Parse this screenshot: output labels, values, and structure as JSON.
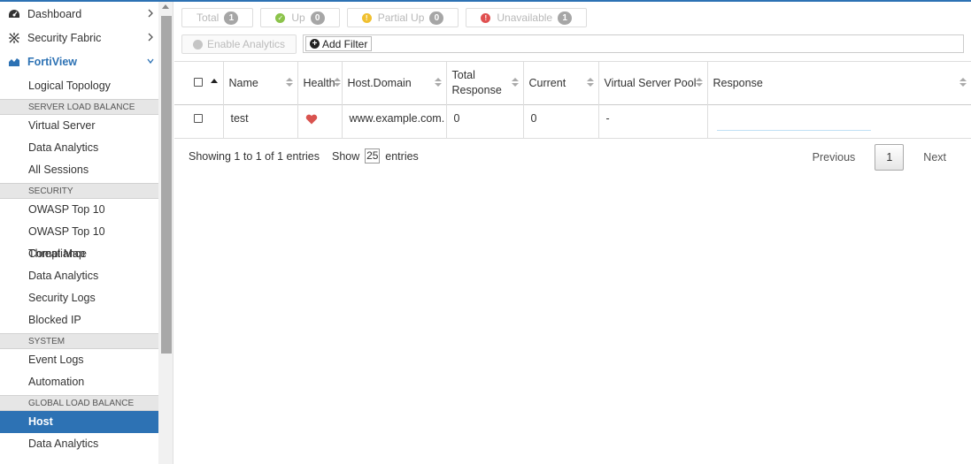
{
  "sidebar": {
    "top_items": [
      {
        "label": "Dashboard",
        "icon": "dashboard-icon"
      },
      {
        "label": "Security Fabric",
        "icon": "security-fabric-icon"
      },
      {
        "label": "FortiView",
        "icon": "fortiview-icon"
      }
    ],
    "logical_topology": "Logical Topology",
    "sections": [
      {
        "title": "SERVER LOAD BALANCE",
        "items": [
          "Virtual Server",
          "Data Analytics",
          "All Sessions"
        ]
      },
      {
        "title": "SECURITY",
        "items": [
          "OWASP Top 10",
          "OWASP Top 10 Compliance",
          "Threat Map",
          "Data Analytics",
          "Security Logs",
          "Blocked IP"
        ]
      },
      {
        "title": "SYSTEM",
        "items": [
          "Event Logs",
          "Automation"
        ]
      },
      {
        "title": "GLOBAL LOAD BALANCE",
        "items": [
          "Host",
          "Data Analytics"
        ]
      }
    ],
    "selected": "Host"
  },
  "status": {
    "total": {
      "label": "Total",
      "count": "1"
    },
    "up": {
      "label": "Up",
      "count": "0",
      "color": "#8bc34a"
    },
    "partial": {
      "label": "Partial Up",
      "count": "0",
      "color": "#f0c030"
    },
    "unavailable": {
      "label": "Unavailable",
      "count": "1",
      "color": "#e05050"
    }
  },
  "toolbar": {
    "enable_analytics": "Enable Analytics",
    "add_filter": "Add Filter"
  },
  "table": {
    "columns": [
      "Name",
      "Health",
      "Host.Domain",
      "Total Response",
      "Current",
      "Virtual Server Pool",
      "Response"
    ],
    "rows": [
      {
        "name": "test",
        "health": "heart-icon",
        "host_domain": "www.example.com.",
        "total_response": "0",
        "current": "0",
        "virtual_server_pool": "-"
      }
    ]
  },
  "footer": {
    "info": "Showing 1 to 1 of 1 entries",
    "show": "Show",
    "page_size": "25",
    "entries": "entries",
    "previous": "Previous",
    "page": "1",
    "next": "Next"
  }
}
